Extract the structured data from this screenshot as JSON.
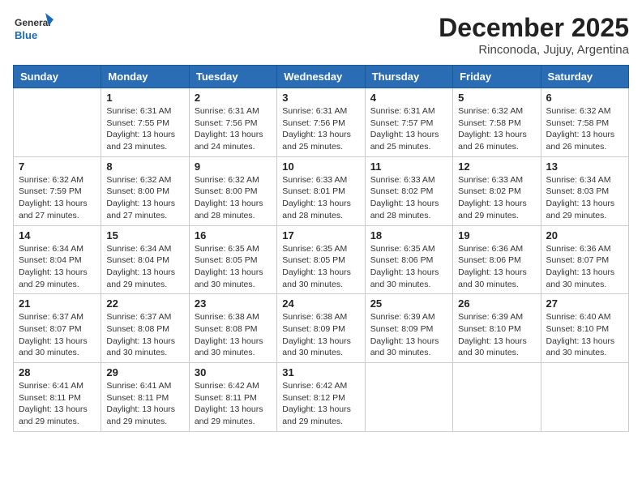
{
  "header": {
    "logo_general": "General",
    "logo_blue": "Blue",
    "month_title": "December 2025",
    "location": "Rinconoda, Jujuy, Argentina"
  },
  "days_of_week": [
    "Sunday",
    "Monday",
    "Tuesday",
    "Wednesday",
    "Thursday",
    "Friday",
    "Saturday"
  ],
  "weeks": [
    [
      {
        "day": "",
        "info": ""
      },
      {
        "day": "1",
        "info": "Sunrise: 6:31 AM\nSunset: 7:55 PM\nDaylight: 13 hours\nand 23 minutes."
      },
      {
        "day": "2",
        "info": "Sunrise: 6:31 AM\nSunset: 7:56 PM\nDaylight: 13 hours\nand 24 minutes."
      },
      {
        "day": "3",
        "info": "Sunrise: 6:31 AM\nSunset: 7:56 PM\nDaylight: 13 hours\nand 25 minutes."
      },
      {
        "day": "4",
        "info": "Sunrise: 6:31 AM\nSunset: 7:57 PM\nDaylight: 13 hours\nand 25 minutes."
      },
      {
        "day": "5",
        "info": "Sunrise: 6:32 AM\nSunset: 7:58 PM\nDaylight: 13 hours\nand 26 minutes."
      },
      {
        "day": "6",
        "info": "Sunrise: 6:32 AM\nSunset: 7:58 PM\nDaylight: 13 hours\nand 26 minutes."
      }
    ],
    [
      {
        "day": "7",
        "info": "Sunrise: 6:32 AM\nSunset: 7:59 PM\nDaylight: 13 hours\nand 27 minutes."
      },
      {
        "day": "8",
        "info": "Sunrise: 6:32 AM\nSunset: 8:00 PM\nDaylight: 13 hours\nand 27 minutes."
      },
      {
        "day": "9",
        "info": "Sunrise: 6:32 AM\nSunset: 8:00 PM\nDaylight: 13 hours\nand 28 minutes."
      },
      {
        "day": "10",
        "info": "Sunrise: 6:33 AM\nSunset: 8:01 PM\nDaylight: 13 hours\nand 28 minutes."
      },
      {
        "day": "11",
        "info": "Sunrise: 6:33 AM\nSunset: 8:02 PM\nDaylight: 13 hours\nand 28 minutes."
      },
      {
        "day": "12",
        "info": "Sunrise: 6:33 AM\nSunset: 8:02 PM\nDaylight: 13 hours\nand 29 minutes."
      },
      {
        "day": "13",
        "info": "Sunrise: 6:34 AM\nSunset: 8:03 PM\nDaylight: 13 hours\nand 29 minutes."
      }
    ],
    [
      {
        "day": "14",
        "info": "Sunrise: 6:34 AM\nSunset: 8:04 PM\nDaylight: 13 hours\nand 29 minutes."
      },
      {
        "day": "15",
        "info": "Sunrise: 6:34 AM\nSunset: 8:04 PM\nDaylight: 13 hours\nand 29 minutes."
      },
      {
        "day": "16",
        "info": "Sunrise: 6:35 AM\nSunset: 8:05 PM\nDaylight: 13 hours\nand 30 minutes."
      },
      {
        "day": "17",
        "info": "Sunrise: 6:35 AM\nSunset: 8:05 PM\nDaylight: 13 hours\nand 30 minutes."
      },
      {
        "day": "18",
        "info": "Sunrise: 6:35 AM\nSunset: 8:06 PM\nDaylight: 13 hours\nand 30 minutes."
      },
      {
        "day": "19",
        "info": "Sunrise: 6:36 AM\nSunset: 8:06 PM\nDaylight: 13 hours\nand 30 minutes."
      },
      {
        "day": "20",
        "info": "Sunrise: 6:36 AM\nSunset: 8:07 PM\nDaylight: 13 hours\nand 30 minutes."
      }
    ],
    [
      {
        "day": "21",
        "info": "Sunrise: 6:37 AM\nSunset: 8:07 PM\nDaylight: 13 hours\nand 30 minutes."
      },
      {
        "day": "22",
        "info": "Sunrise: 6:37 AM\nSunset: 8:08 PM\nDaylight: 13 hours\nand 30 minutes."
      },
      {
        "day": "23",
        "info": "Sunrise: 6:38 AM\nSunset: 8:08 PM\nDaylight: 13 hours\nand 30 minutes."
      },
      {
        "day": "24",
        "info": "Sunrise: 6:38 AM\nSunset: 8:09 PM\nDaylight: 13 hours\nand 30 minutes."
      },
      {
        "day": "25",
        "info": "Sunrise: 6:39 AM\nSunset: 8:09 PM\nDaylight: 13 hours\nand 30 minutes."
      },
      {
        "day": "26",
        "info": "Sunrise: 6:39 AM\nSunset: 8:10 PM\nDaylight: 13 hours\nand 30 minutes."
      },
      {
        "day": "27",
        "info": "Sunrise: 6:40 AM\nSunset: 8:10 PM\nDaylight: 13 hours\nand 30 minutes."
      }
    ],
    [
      {
        "day": "28",
        "info": "Sunrise: 6:41 AM\nSunset: 8:11 PM\nDaylight: 13 hours\nand 29 minutes."
      },
      {
        "day": "29",
        "info": "Sunrise: 6:41 AM\nSunset: 8:11 PM\nDaylight: 13 hours\nand 29 minutes."
      },
      {
        "day": "30",
        "info": "Sunrise: 6:42 AM\nSunset: 8:11 PM\nDaylight: 13 hours\nand 29 minutes."
      },
      {
        "day": "31",
        "info": "Sunrise: 6:42 AM\nSunset: 8:12 PM\nDaylight: 13 hours\nand 29 minutes."
      },
      {
        "day": "",
        "info": ""
      },
      {
        "day": "",
        "info": ""
      },
      {
        "day": "",
        "info": ""
      }
    ]
  ]
}
